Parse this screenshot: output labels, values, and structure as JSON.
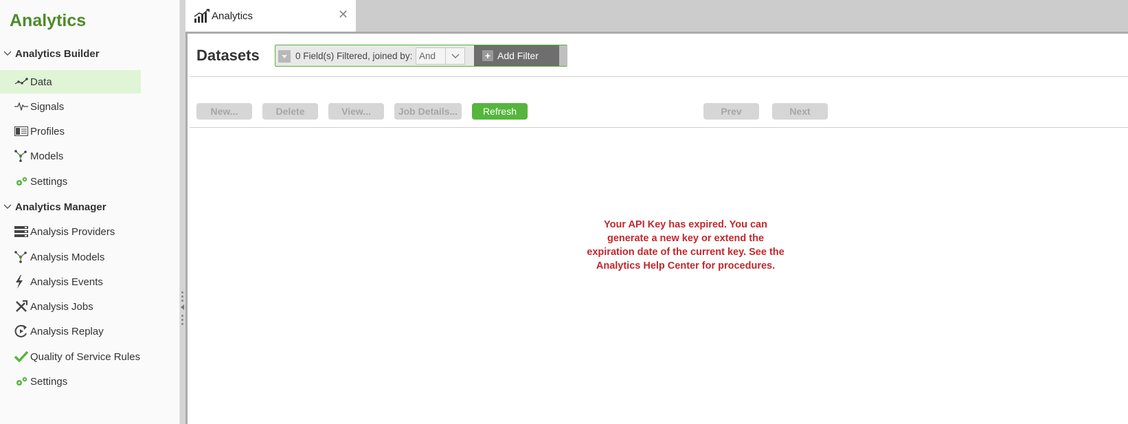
{
  "sidebar": {
    "app_title": "Analytics",
    "sections": [
      {
        "label": "Analytics Builder",
        "items": [
          {
            "label": "Data",
            "icon": "data-icon",
            "selected": true
          },
          {
            "label": "Signals",
            "icon": "signals-icon"
          },
          {
            "label": "Profiles",
            "icon": "profiles-icon"
          },
          {
            "label": "Models",
            "icon": "models-icon"
          },
          {
            "label": "Settings",
            "icon": "gears-icon"
          }
        ]
      },
      {
        "label": "Analytics Manager",
        "items": [
          {
            "label": "Analysis Providers",
            "icon": "server-icon"
          },
          {
            "label": "Analysis Models",
            "icon": "models-icon"
          },
          {
            "label": "Analysis Events",
            "icon": "lightning-icon"
          },
          {
            "label": "Analysis Jobs",
            "icon": "tools-icon"
          },
          {
            "label": "Analysis Replay",
            "icon": "replay-icon"
          },
          {
            "label": "Quality of Service Rules",
            "icon": "checkmark-icon"
          },
          {
            "label": "Settings",
            "icon": "gears-icon"
          }
        ]
      }
    ]
  },
  "tab": {
    "label": "Analytics",
    "icon": "analytics-chart-icon"
  },
  "page": {
    "title": "Datasets",
    "filter": {
      "text": "0 Field(s) Filtered, joined by:",
      "join_value": "And",
      "add_label": "Add Filter"
    },
    "buttons": {
      "new": "New...",
      "delete": "Delete",
      "view": "View...",
      "job_details": "Job Details...",
      "refresh": "Refresh",
      "prev": "Prev",
      "next": "Next"
    },
    "message": "Your API Key has expired. You can generate a new key or extend the expiration date of the current key. See the Analytics Help Center for procedures."
  },
  "colors": {
    "brand_green": "#4e8b2c",
    "selected_bg": "#dff5d6",
    "primary_button": "#55b53d",
    "error_text": "#c3272b"
  }
}
